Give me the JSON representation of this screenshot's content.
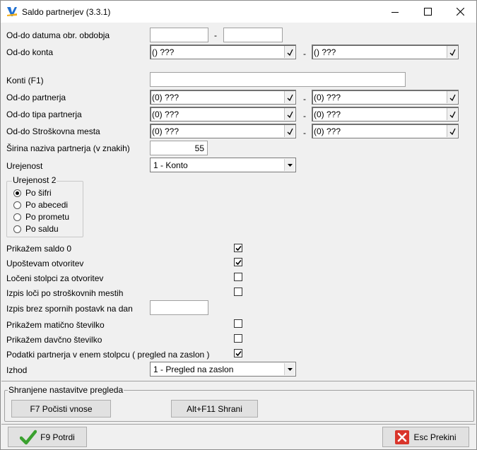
{
  "window": {
    "title": "Saldo partnerjev  (3.3.1)"
  },
  "labels": {
    "date_range": "Od-do datuma obr. obdobja",
    "account_range": "Od-do konta",
    "accounts": "Konti (F1)",
    "partner_range": "Od-do partnerja",
    "partner_type_range": "Od-do tipa partnerja",
    "cost_center_range": "Od-do Stroškovna mesta",
    "partner_name_width": "Širina naziva partnerja (v znakih)",
    "ordering": "Urejenost",
    "output": "Izhod",
    "dash": "-"
  },
  "fields": {
    "date_from": "",
    "date_to": "",
    "account_from": "() ???",
    "account_to": "() ???",
    "accounts": "",
    "partner_from": "(0) ???",
    "partner_to": "(0) ???",
    "partner_type_from": "(0) ???",
    "partner_type_to": "(0) ???",
    "cost_center_from": "(0) ???",
    "cost_center_to": "(0) ???",
    "partner_name_width": "55",
    "ordering": "1 - Konto",
    "disputed_date": "",
    "output": "1 - Pregled na zaslon"
  },
  "ordering2": {
    "title": "Urejenost 2",
    "options": [
      {
        "label": "Po šifri",
        "selected": true
      },
      {
        "label": "Po abecedi",
        "selected": false
      },
      {
        "label": "Po prometu",
        "selected": false
      },
      {
        "label": "Po saldu",
        "selected": false
      }
    ]
  },
  "checks": [
    {
      "label": "Prikažem saldo 0",
      "checked": true
    },
    {
      "label": "Upoštevam otvoritev",
      "checked": true
    },
    {
      "label": "Ločeni stolpci za otvoritev",
      "checked": false
    },
    {
      "label": "Izpis loči po stroškovnih mestih",
      "checked": false
    },
    {
      "label": "Izpis brez spornih postavk na dan",
      "checked": null
    },
    {
      "label": "Prikažem matično številko",
      "checked": false
    },
    {
      "label": "Prikažem davčno številko",
      "checked": false
    },
    {
      "label": "Podatki partnerja v enem stolpcu ( pregled na zaslon )",
      "checked": true
    }
  ],
  "settings_group": {
    "title": "Shranjene nastavitve pregleda",
    "clear_button": "F7 Počisti vnose",
    "save_button": "Alt+F11 Shrani"
  },
  "footer": {
    "confirm_button": "F9 Potrdi",
    "cancel_button": "Esc Prekini"
  },
  "colors": {
    "confirm_icon": "#3aa12f",
    "cancel_icon": "#d9352b",
    "app_icon": "#1f6fd1"
  }
}
